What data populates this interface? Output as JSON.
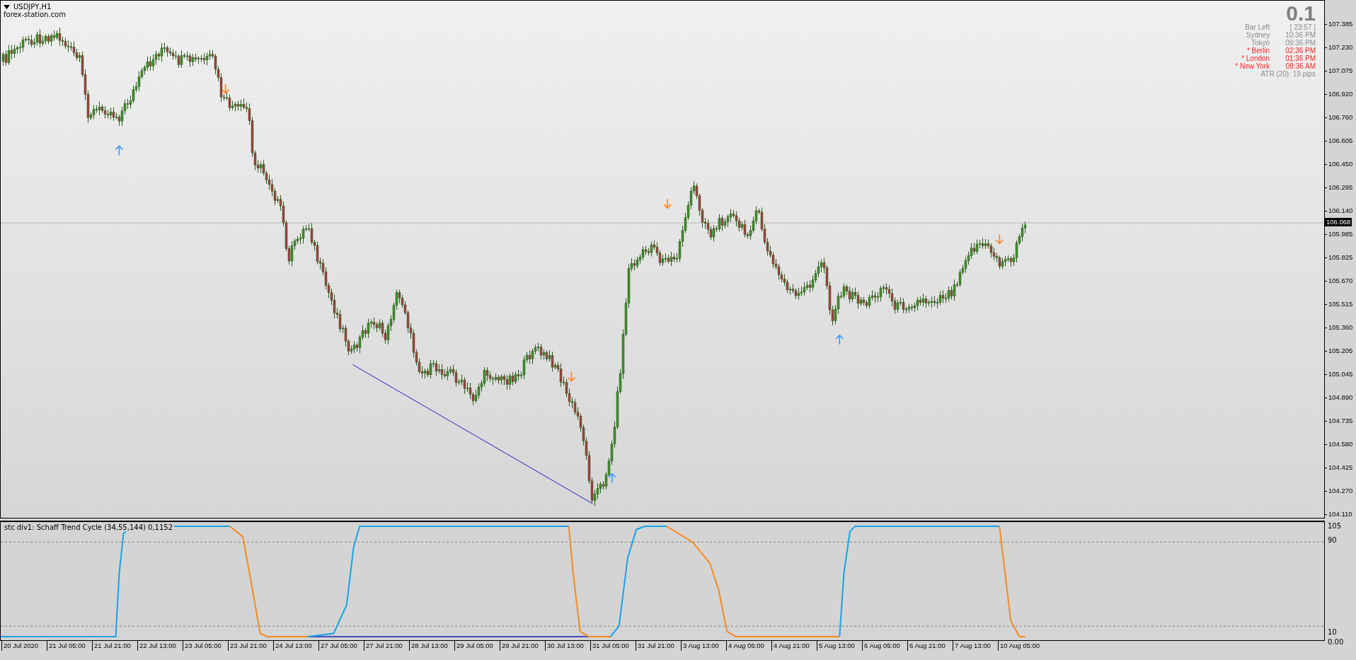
{
  "chart": {
    "title": "USDJPY,H1",
    "subtitle": "forex-station.com"
  },
  "info_panel": {
    "big_value": "0.1",
    "rows": [
      {
        "label": "Bar Left",
        "value": "[ 23:57 ]",
        "open": false
      },
      {
        "label": "Sydney",
        "value": "10:36 PM",
        "open": false
      },
      {
        "label": "Tokyo",
        "value": "09:36 PM",
        "open": false
      },
      {
        "label": "* Berlin",
        "value": "02:36 PM",
        "open": true
      },
      {
        "label": "* London",
        "value": "01:36 PM",
        "open": true
      },
      {
        "label": "* New York",
        "value": "08:36 AM",
        "open": true
      }
    ],
    "atr": "ATR (20): 19 pips"
  },
  "price_axis": {
    "labels": [
      "107.385",
      "107.230",
      "107.075",
      "106.920",
      "106.760",
      "106.605",
      "106.450",
      "106.295",
      "106.140",
      "105.985",
      "105.825",
      "105.670",
      "105.515",
      "105.360",
      "105.205",
      "105.045",
      "104.890",
      "104.735",
      "104.580",
      "104.425",
      "104.270",
      "104.110"
    ],
    "current_price": "106.068"
  },
  "indicator": {
    "label": "stc div1: Schaff Trend Cycle (34,55,144) 0,1152",
    "axis_labels": [
      "105",
      "90",
      "10",
      "0.00"
    ]
  },
  "time_axis": [
    "20 Jul 2020",
    "21 Jul 05:00",
    "21 Jul 21:00",
    "22 Jul 13:00",
    "23 Jul 05:00",
    "23 Jul 21:00",
    "24 Jul 13:00",
    "27 Jul 05:00",
    "27 Jul 21:00",
    "28 Jul 13:00",
    "29 Jul 05:00",
    "29 Jul 21:00",
    "30 Jul 13:00",
    "31 Jul 05:00",
    "31 Jul 21:00",
    "3 Aug 13:00",
    "4 Aug 05:00",
    "4 Aug 21:00",
    "5 Aug 13:00",
    "6 Aug 05:00",
    "6 Aug 21:00",
    "7 Aug 13:00",
    "10 Aug 05:00"
  ]
}
